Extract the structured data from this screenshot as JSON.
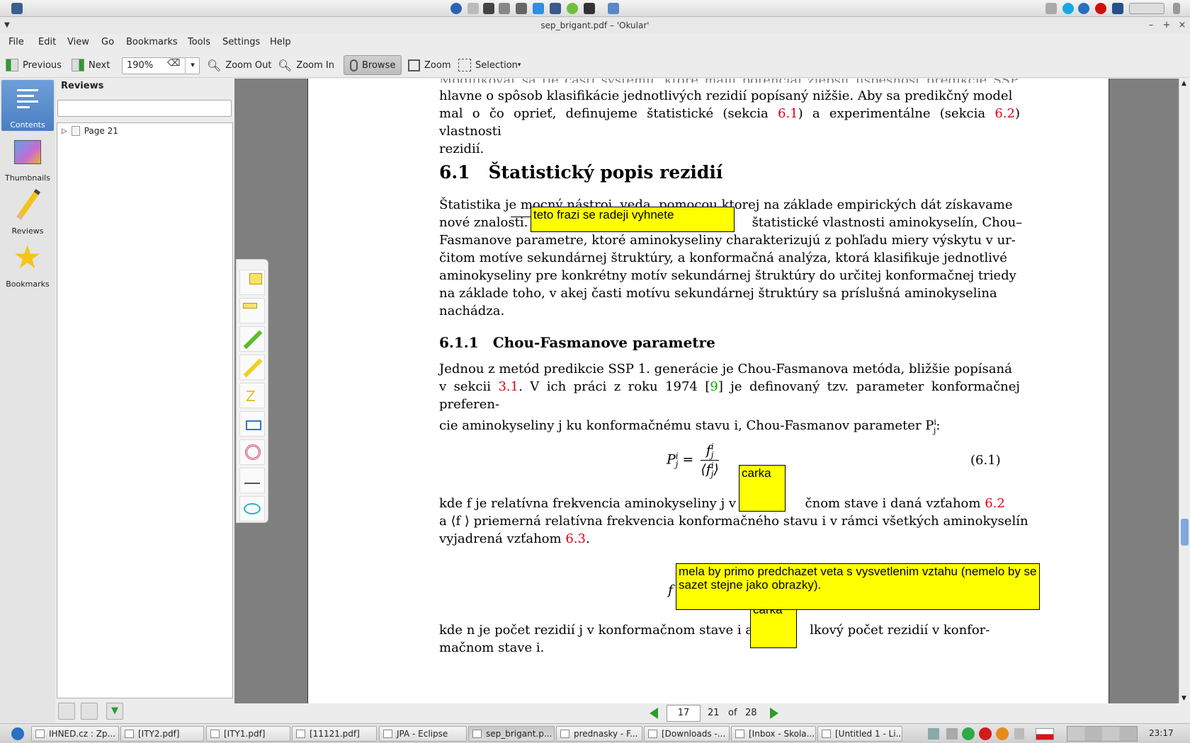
{
  "window": {
    "title": "sep_brigant.pdf – 'Okular'"
  },
  "menubar": {
    "items": [
      "File",
      "Edit",
      "View",
      "Go",
      "Bookmarks",
      "Tools",
      "Settings",
      "Help"
    ]
  },
  "toolbar": {
    "previous_label": "Previous",
    "next_label": "Next",
    "zoom_value": "190%",
    "zoom_out_label": "Zoom Out",
    "zoom_in_label": "Zoom In",
    "browse_label": "Browse",
    "zoom_label": "Zoom",
    "selection_label": "Selection"
  },
  "sidebar": {
    "tabs": [
      {
        "label": "Contents",
        "icon": "contents-icon",
        "active": true
      },
      {
        "label": "Thumbnails",
        "icon": "thumbnails-icon",
        "active": false
      },
      {
        "label": "Reviews",
        "icon": "pencil-icon",
        "active": false
      },
      {
        "label": "Bookmarks",
        "icon": "star-icon",
        "active": false
      }
    ]
  },
  "reviews": {
    "title": "Reviews",
    "search_value": "",
    "tree": [
      {
        "label": "Page 21"
      }
    ]
  },
  "document": {
    "para_top_line1": "hlavne o spôsob klasifikácie jednotlivých rezidií popísaný nižšie. Aby sa predikčný model",
    "para_top_line2a": "mal o čo oprieť, definujeme štatistické (sekcia ",
    "ref_6_1": "6.1",
    "para_top_line2b": ") a experimentálne (sekcia ",
    "ref_6_2": "6.2",
    "para_top_line2c": ") vlastnosti",
    "para_top_line3": "rezidií.",
    "section_num": "6.1",
    "section_title": "Štatistický popis rezidií",
    "para_stat": [
      "Štatistika je mocný nástroj, veda, pomocou ktorej na základe empirických dát získavame",
      "nové znalosti. V                                                    štatistické vlastnosti aminokyselín, Chou–",
      "Fasmanove parametre, ktoré aminokyseliny charakterizujú z pohľadu miery výskytu v ur-",
      "čitom motíve sekundárnej štruktúry, a konformačná analýza, ktorá klasifikuje jednotlivé",
      "aminokyseliny pre konkrétny motív sekundárnej štruktúry do určitej konformačnej triedy",
      "na základe toho, v akej časti motívu sekundárnej štruktúry sa príslušná aminokyselina",
      "nachádza."
    ],
    "subsection_num": "6.1.1",
    "subsection_title": "Chou-Fasmanove parametre",
    "para_cf_line1": "Jednou z metód predikcie SSP 1. generácie je Chou-Fasmanova metóda, bližšie popísaná",
    "para_cf_line2a": "v sekcii ",
    "ref_3_1": "3.1",
    "para_cf_line2b": ". V ich práci z roku 1974 [",
    "cite_9": "9",
    "para_cf_line2c": "] je definovaný tzv. parameter konformačnej preferen-",
    "para_cf_line3": "cie aminokyseliny j ku konformačnému stavu i, Chou-Fasmanov parameter P",
    "eq_number": "(6.1)",
    "para_kde1_line1a": "kde f  je relatívna frekvencia aminokyseliny j v ko",
    "para_kde1_line1b": "čnom stave i daná vzťahom ",
    "ref_6_2b": "6.2",
    "para_kde1_line2": "a ⟨f ⟩ priemerná relatívna frekvencia konformačného stavu i v rámci všetkých aminokyselín",
    "para_kde1_line3a": "vyjadrená vzťahom ",
    "ref_6_3": "6.3",
    "para_kde1_line3b": ".",
    "para_kde2_line1a": "kde n  je počet rezidií j v konformačnom stave i a",
    "para_kde2_line1b": "lkový počet rezidií v konfor-",
    "para_kde2_line2": "mačnom stave i."
  },
  "annotations": [
    {
      "text": "teto frazi se radeji vyhnete"
    },
    {
      "text": "carka"
    },
    {
      "text": "mela by primo predchazet veta s vysvetlenim vztahu (nemelo by se sazet stejne jako obrazky)."
    },
    {
      "text": "carka"
    }
  ],
  "pagenav": {
    "current": "17",
    "page_label": "21",
    "of_label": "of",
    "total": "28"
  },
  "taskbar": {
    "tasks": [
      "IHNED.cz : Zp...",
      "[ITY2.pdf]",
      "[ITY1.pdf]",
      "[11121.pdf]",
      "JPA - Eclipse",
      "sep_brigant.p...",
      "prednasky - F...",
      "[Downloads -...",
      "[Inbox - Skola...",
      "[Untitled 1 - Li..."
    ],
    "clock": "23:17"
  }
}
